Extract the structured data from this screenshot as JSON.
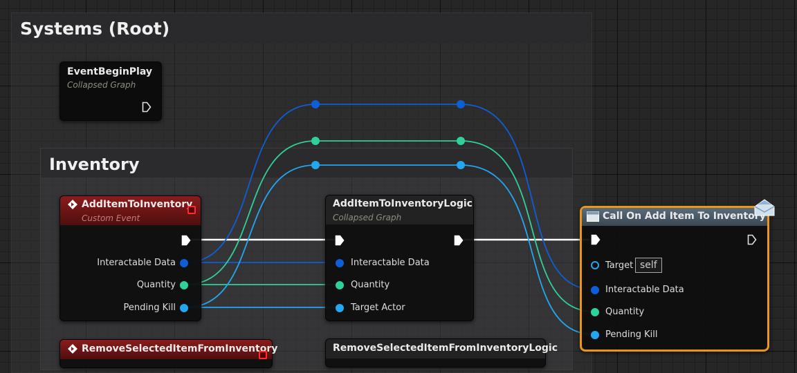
{
  "comments": {
    "systems": "Systems (Root)",
    "inventory": "Inventory"
  },
  "nodes": {
    "begin_play": {
      "title": "EventBeginPlay",
      "subtitle": "Collapsed Graph"
    },
    "add_item": {
      "title": "AddItemToInventory",
      "subtitle": "Custom Event",
      "pins": [
        "Interactable Data",
        "Quantity",
        "Pending Kill"
      ]
    },
    "logic": {
      "title": "AddItemToInventoryLogic",
      "subtitle": "Collapsed Graph",
      "pins": [
        "Interactable Data",
        "Quantity",
        "Target Actor"
      ]
    },
    "call": {
      "title": "Call On Add Item To Inventory",
      "target_label": "Target",
      "target_value": "self",
      "pins": [
        "Interactable Data",
        "Quantity",
        "Pending Kill"
      ]
    },
    "remove": {
      "title": "RemoveSelectedItemFromInventory"
    },
    "remove_logic": {
      "title": "RemoveSelectedItemFromInventoryLogic"
    }
  },
  "colors": {
    "struct_pin": "#0d5fd6",
    "int_pin": "#2fd198",
    "object_pin": "#22a7f0",
    "exec_wire": "#ffffff",
    "selection": "#e8961c",
    "event_header": "#8a1c1c"
  },
  "icons": {
    "exec_pin": "exec-arrow-icon",
    "function_header": "function-icon",
    "event_header": "event-diamond-icon",
    "message": "envelope-icon",
    "stop": "stop-icon"
  }
}
